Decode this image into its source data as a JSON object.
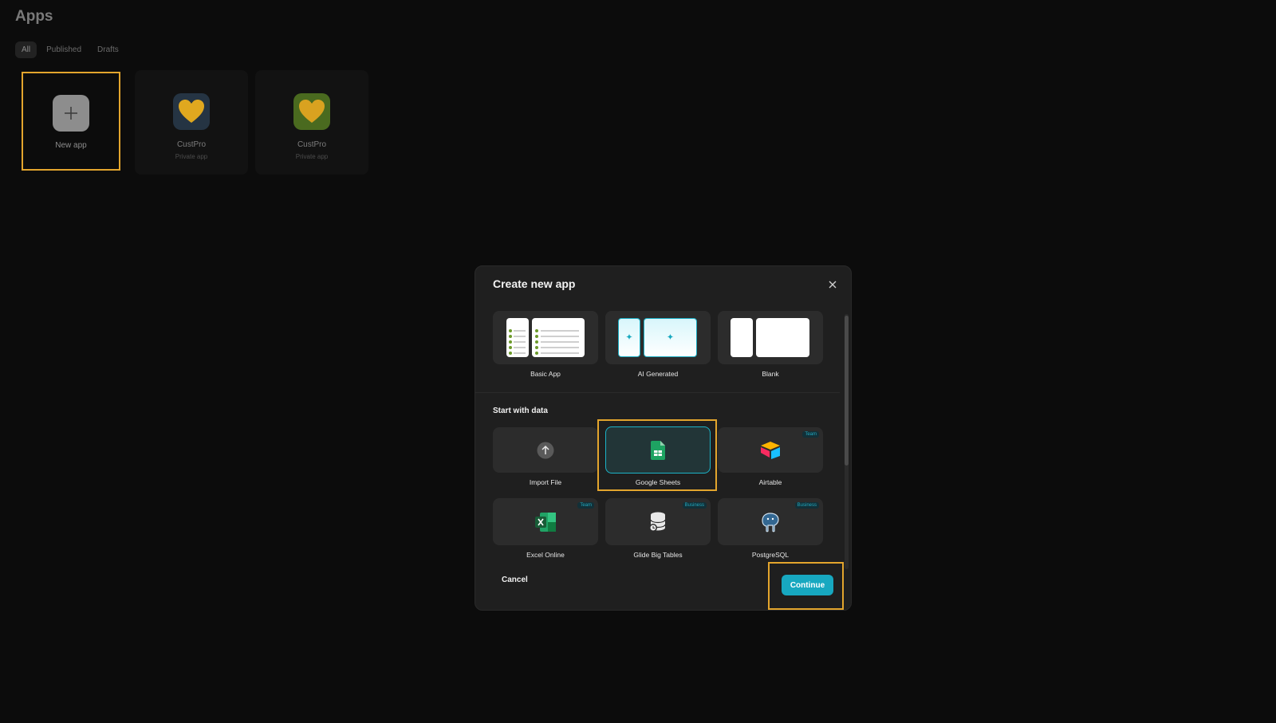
{
  "page": {
    "title": "Apps",
    "filters": [
      "All",
      "Published",
      "Drafts"
    ]
  },
  "cards": {
    "new_app": "New app",
    "apps": [
      {
        "name": "CustPro",
        "sub": "Private app"
      },
      {
        "name": "CustPro",
        "sub": "Private app"
      }
    ]
  },
  "modal": {
    "title": "Create new app",
    "templates": [
      "Basic App",
      "AI Generated",
      "Blank"
    ],
    "section_title": "Start with data",
    "sources": [
      {
        "label": "Import File",
        "badge": ""
      },
      {
        "label": "Google Sheets",
        "badge": ""
      },
      {
        "label": "Airtable",
        "badge": "Team"
      },
      {
        "label": "Excel Online",
        "badge": "Team"
      },
      {
        "label": "Glide Big Tables",
        "badge": "Business"
      },
      {
        "label": "PostgreSQL",
        "badge": "Business"
      }
    ],
    "cancel": "Cancel",
    "continue": "Continue"
  },
  "colors": {
    "accent": "#17a8c0",
    "highlight": "#e3a52d"
  },
  "icons": {
    "close": "close-icon",
    "new_app": "plus-icon",
    "import": "upload-arrow-icon",
    "sheets": "google-sheets-icon",
    "airtable": "airtable-icon",
    "excel": "excel-icon",
    "bigtables": "database-icon",
    "postgres": "postgresql-elephant-icon",
    "ai": "sparkle-icon"
  }
}
